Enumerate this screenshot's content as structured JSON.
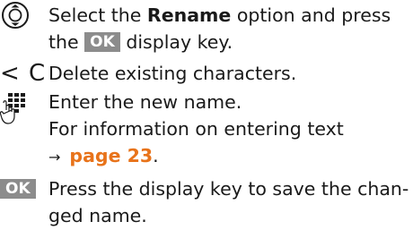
{
  "steps": [
    {
      "icon": "navigation-control-icon",
      "lines": [
        "Select the ",
        "Rename",
        " option and press",
        "the ",
        "OK",
        " display key."
      ]
    },
    {
      "icon_text": "< C",
      "text": "Delete existing characters."
    },
    {
      "icon": "keypad-icon",
      "line1": "Enter the new name.",
      "line2": "For information on entering text",
      "link_arrow": "→",
      "link_text": "page 23",
      "link_after": "."
    },
    {
      "key_label": "OK",
      "line1": "Press the display key to save the chan-",
      "line2": "ged name."
    }
  ]
}
